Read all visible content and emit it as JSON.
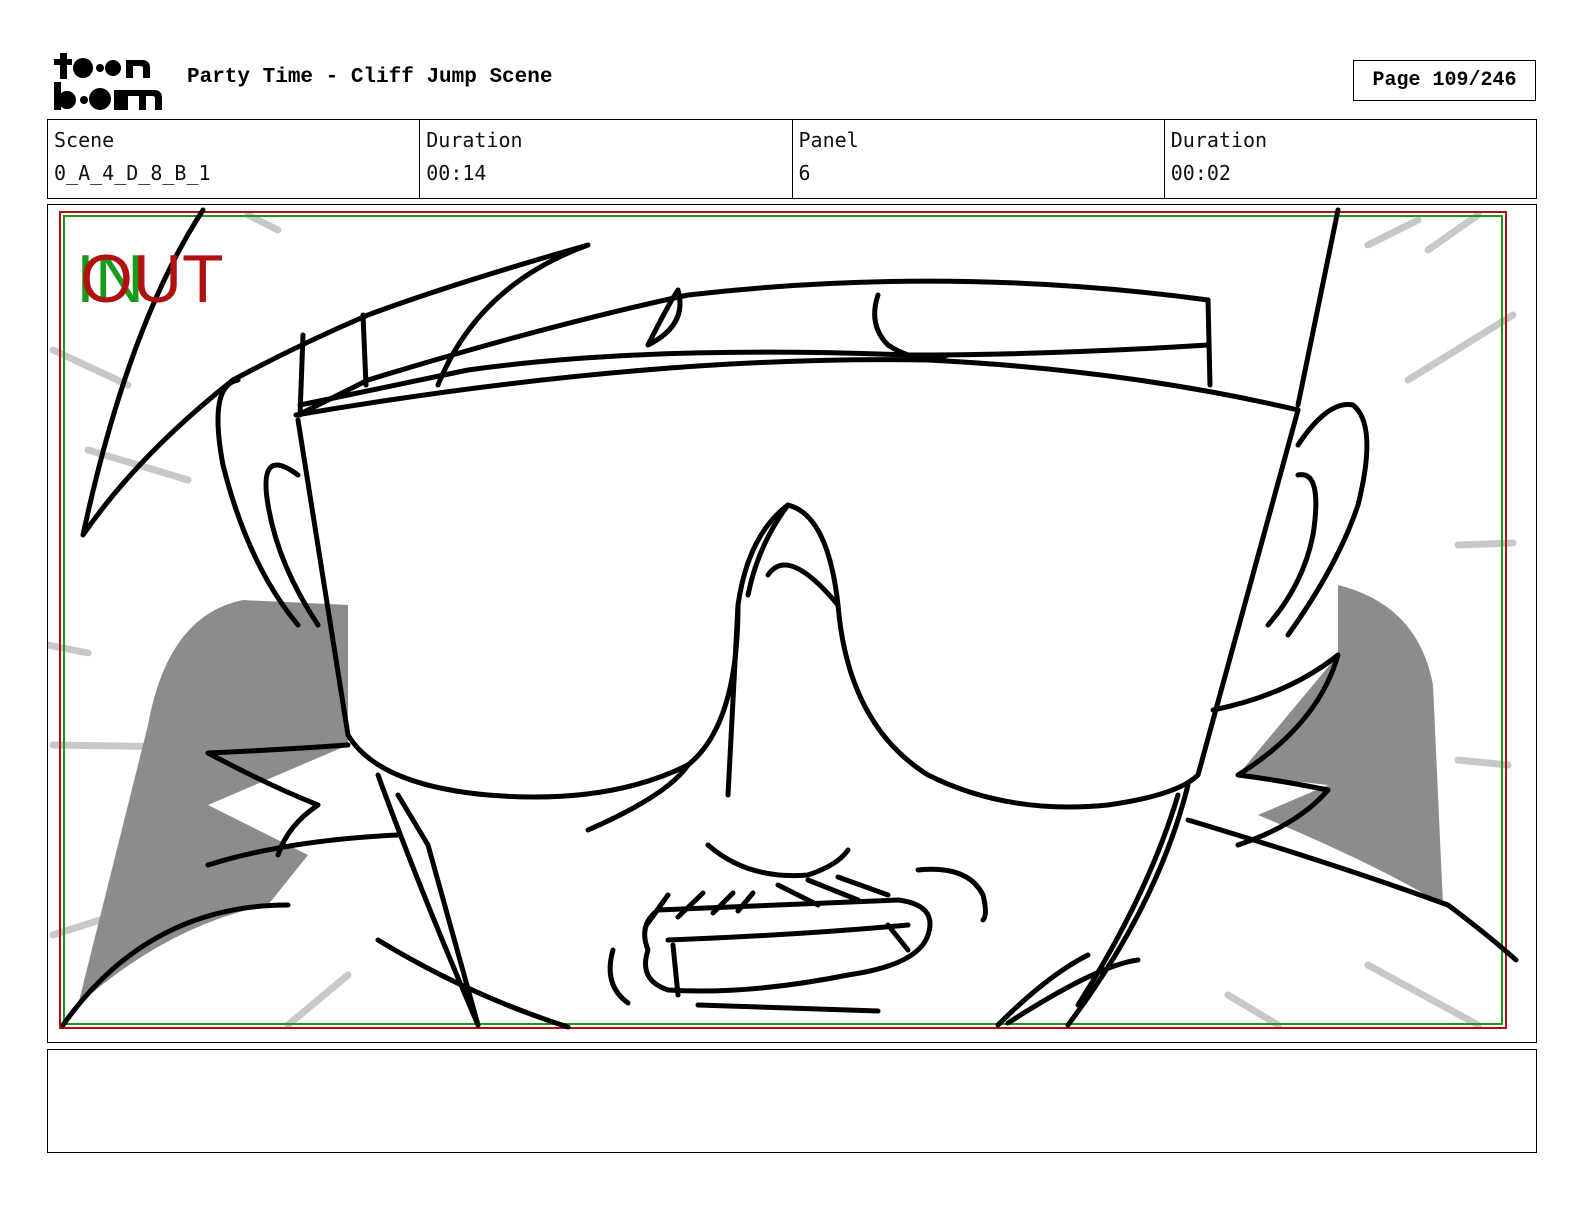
{
  "header": {
    "logo_text": "toon boom",
    "title": "Party Time - Cliff Jump Scene",
    "page_label": "Page 109/246"
  },
  "info": {
    "scene_label": "Scene",
    "scene_value": "0_A_4_D_8_B_1",
    "scene_duration_label": "Duration",
    "scene_duration_value": "00:14",
    "panel_label": "Panel",
    "panel_value": "6",
    "panel_duration_label": "Duration",
    "panel_duration_value": "00:02"
  },
  "panel_overlay": {
    "in_label": "IN",
    "out_label": "OUT",
    "in_color": "#1a9a1a",
    "out_color": "#b01010"
  },
  "notes": {
    "text": ""
  }
}
